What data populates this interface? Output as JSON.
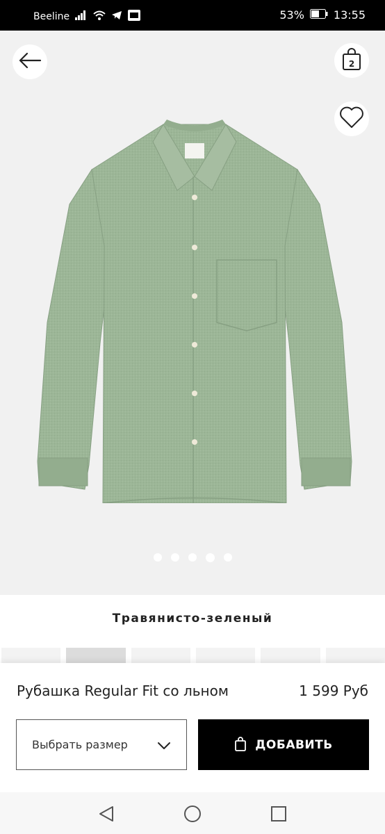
{
  "status_bar": {
    "carrier": "Beeline",
    "battery": "53%",
    "time": "13:55"
  },
  "header": {
    "bag_count": "2"
  },
  "gallery": {
    "image_count": 5,
    "active_index": 3
  },
  "product": {
    "color_name": "Травянисто-зеленый",
    "title": "Рубашка Regular Fit со льном",
    "price": "1 599 Руб",
    "swatch_count": 6,
    "selected_swatch": 1
  },
  "actions": {
    "size_placeholder": "Выбрать размер",
    "add_label": "ДОБАВИТЬ"
  },
  "icons": {
    "back": "arrow-left-icon",
    "bag": "shopping-bag-icon",
    "favorite": "heart-icon",
    "chevron": "chevron-down-icon",
    "nav_back": "triangle-back-icon",
    "nav_home": "circle-home-icon",
    "nav_recent": "square-recent-icon"
  },
  "colors": {
    "shirt": "#9bb596",
    "hero_bg": "#f1f1f1",
    "button_bg": "#000000"
  }
}
